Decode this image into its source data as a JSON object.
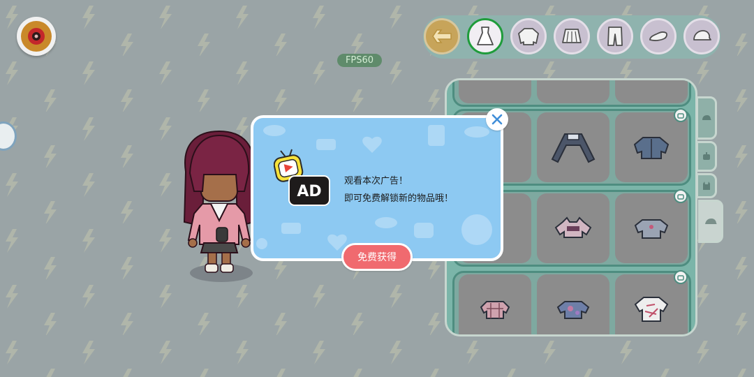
{
  "hud": {
    "fps_label": "FPS60",
    "top_left_button_icon": "ladybug-icon"
  },
  "categories": {
    "items": [
      {
        "icon": "back-arrow-icon",
        "active": false
      },
      {
        "icon": "dress-icon",
        "active": true
      },
      {
        "icon": "jacket-icon",
        "active": false
      },
      {
        "icon": "skirt-icon",
        "active": false
      },
      {
        "icon": "pants-icon",
        "active": false
      },
      {
        "icon": "shoe-icon",
        "active": false
      },
      {
        "icon": "hat-icon",
        "active": false
      }
    ]
  },
  "side_tabs": {
    "items": [
      {
        "icon": "hat-icon"
      },
      {
        "icon": "robot-icon"
      },
      {
        "icon": "tank-top-icon"
      },
      {
        "icon": "cap-icon"
      }
    ]
  },
  "item_grid": {
    "rows": [
      {
        "ad_locked": true,
        "items": [
          "sleeves-outfit",
          "mech-arms-top",
          "denim-jacket"
        ]
      },
      {
        "ad_locked": true,
        "items": [
          "partial-item",
          "cat-crop-top",
          "knit-top"
        ]
      },
      {
        "ad_locked": true,
        "items": [
          "plaid-top",
          "tie-dye-top",
          "graffiti-tee"
        ]
      }
    ]
  },
  "ad_modal": {
    "logo_text": "AD",
    "message_line1": "观看本次广告！",
    "message_line2": "即可免费解锁新的物品哦！",
    "cta_label": "免费获得",
    "colors": {
      "background": "#8dc9f2",
      "cta": "#f06a6f",
      "border": "#ffffff"
    }
  },
  "colors": {
    "background": "#9aa4a6",
    "panel": "#7bb5a9",
    "active_category_ring": "#1f9c3b"
  }
}
